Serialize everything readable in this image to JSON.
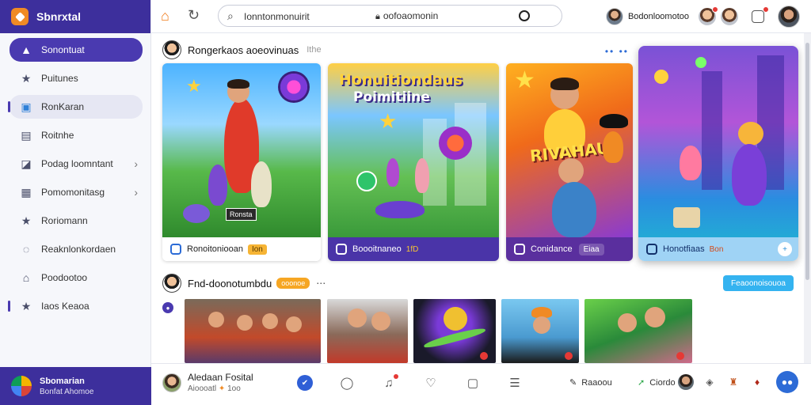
{
  "app": {
    "brand": "Sbnrxtal",
    "footer_title": "Sbomarian",
    "footer_subtitle": "Bonfat Ahomoe"
  },
  "sidebar": {
    "items": [
      {
        "label": "Sonontuat",
        "icon": "triangle-icon"
      },
      {
        "label": "Puitunes",
        "icon": "bookmark-icon"
      },
      {
        "label": "RonKaran",
        "icon": "grid-icon"
      },
      {
        "label": "Roitnhe",
        "icon": "file-icon"
      },
      {
        "label": "Podag loomntant",
        "icon": "folder-icon"
      },
      {
        "label": "Pomomonitasg",
        "icon": "calendar-icon"
      },
      {
        "label": "Roriomann",
        "icon": "star-icon"
      },
      {
        "label": "Reaknlonkordaen",
        "icon": "chat-icon"
      },
      {
        "label": "Poodootoo",
        "icon": "home-icon"
      },
      {
        "label": "Iaos Keaoa",
        "icon": "star-icon"
      }
    ]
  },
  "topbar": {
    "search_value": "Ionntonmonuirit",
    "filter_label": "oofoaomonin",
    "user_label": "Bodonloomotoo"
  },
  "sections": {
    "featured": {
      "title": "Rongerkaos aoeovinuas",
      "subtitle": "Ithe"
    },
    "followed": {
      "title": "Fnd-doonotumbdu",
      "badge": "ooonoe",
      "button": "Feaoonoisouoa"
    }
  },
  "cards": [
    {
      "caption": "Ronoitoniooan",
      "tag": "Ion",
      "sign": "Ronsta"
    },
    {
      "caption": "Boooitnaneo",
      "tag": "1fD",
      "headline_1": "Honuitiondaus",
      "headline_2": "Poimitiine"
    },
    {
      "caption": "Conidance",
      "tag": "Eiaa",
      "banner": "RIVAHAU"
    },
    {
      "caption": "Honotfiaas",
      "tag": "Bon"
    }
  ],
  "bottombar": {
    "name": "Aledaan Fosital",
    "sub": "Aioooatl",
    "sub_tail": "1oo",
    "link_1": "Raaoou",
    "link_2": "Ciordo"
  },
  "colors": {
    "brand_dark": "#3d2f9c",
    "accent_orange": "#f08a24",
    "accent_blue": "#2d6bd6"
  }
}
